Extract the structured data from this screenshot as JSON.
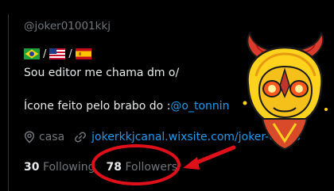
{
  "profile": {
    "handle": "@joker01001kkj",
    "flag_separator": "/",
    "bio_line1": "Sou editor  me chama dm o/",
    "bio_line2_prefix": "Ícone feito pelo brabo do :",
    "bio_line2_mention": "@o_tonnin",
    "location": "casa",
    "website": "jokerkkjcanal.wixsite.com/joker-edit-s"
  },
  "stats": {
    "following_count": "30",
    "following_label": "Following",
    "followers_count": "78",
    "followers_label": "Followers"
  },
  "icons": {
    "flags": [
      "brazil-flag",
      "usa-flag",
      "spain-flag"
    ],
    "location": "location-pin-icon",
    "website": "link-icon"
  },
  "colors": {
    "background": "#000000",
    "text": "#e7e9ea",
    "muted": "#71767b",
    "link": "#1d9bf0",
    "annotation": "#e0101a"
  }
}
